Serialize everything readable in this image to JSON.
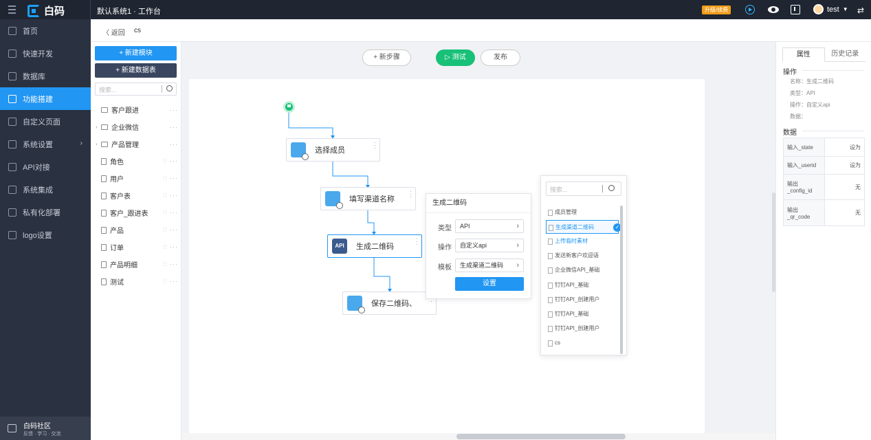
{
  "app": {
    "logo_text": "白码",
    "breadcrumb": "默认系统1 · 工作台",
    "upgrade_label": "升级/续费",
    "user_name": "test"
  },
  "nav": {
    "items": [
      {
        "label": "首页"
      },
      {
        "label": "快速开发"
      },
      {
        "label": "数据库"
      },
      {
        "label": "功能搭建"
      },
      {
        "label": "自定义页面"
      },
      {
        "label": "系统设置"
      },
      {
        "label": "API对接"
      },
      {
        "label": "系统集成"
      },
      {
        "label": "私有化部署"
      },
      {
        "label": "logo设置"
      }
    ],
    "community_title": "白码社区",
    "community_sub": "反馈 · 学习 · 交流"
  },
  "subheader": {
    "back_label": "〈  返回",
    "project_name": "cs"
  },
  "modules": {
    "new_module": "+  新建模块",
    "new_table": "+  新建数据表",
    "search_placeholder": "搜索...",
    "tree": [
      {
        "label": "客户跟进"
      },
      {
        "label": "企业微信"
      },
      {
        "label": "产品管理"
      },
      {
        "label": "角色"
      },
      {
        "label": "用户"
      },
      {
        "label": "客户表"
      },
      {
        "label": "客户_跟进表"
      },
      {
        "label": "产品"
      },
      {
        "label": "订单"
      },
      {
        "label": "产品明细"
      },
      {
        "label": "测试"
      }
    ]
  },
  "toolbar": {
    "add_step": "+ 新步骤",
    "test": "▷ 测试",
    "publish": "发布"
  },
  "flow": {
    "nodes": [
      {
        "label": "选择成员"
      },
      {
        "label": "填写渠道名称"
      },
      {
        "label": "生成二维码",
        "icon_text": "API"
      },
      {
        "label": "保存二维码、"
      }
    ]
  },
  "config": {
    "title": "生成二维码",
    "type_label": "类型",
    "type_value": "API",
    "op_label": "操作",
    "op_value": "自定义api",
    "tpl_label": "模板",
    "tpl_value": "生成渠道二维码",
    "set_button": "设置"
  },
  "dropdown": {
    "search_placeholder": "搜索...",
    "options": [
      {
        "label": "成员管理"
      },
      {
        "label": "生成渠道二维码"
      },
      {
        "label": "上传临时素材"
      },
      {
        "label": "发送新客户欢迎语"
      },
      {
        "label": "企业微信API_基础"
      },
      {
        "label": "钉钉API_基础"
      },
      {
        "label": "钉钉API_创建用户"
      },
      {
        "label": "钉钉API_基础"
      },
      {
        "label": "钉钉API_创建用户"
      },
      {
        "label": "cs"
      }
    ]
  },
  "props": {
    "tab_props": "属性",
    "tab_history": "历史记录",
    "sec_op": "操作",
    "name": "名称：生成二维码",
    "type": "类型：API",
    "op": "操作：自定义api",
    "data": "数据：",
    "sec_data": "数据",
    "rows": [
      {
        "key": "输入_state",
        "value": "设为"
      },
      {
        "key": "输入_userid",
        "value": "设为"
      },
      {
        "key": "输出 _config_id",
        "value": "无"
      },
      {
        "key": "输出 _qr_code",
        "value": "无"
      }
    ]
  }
}
